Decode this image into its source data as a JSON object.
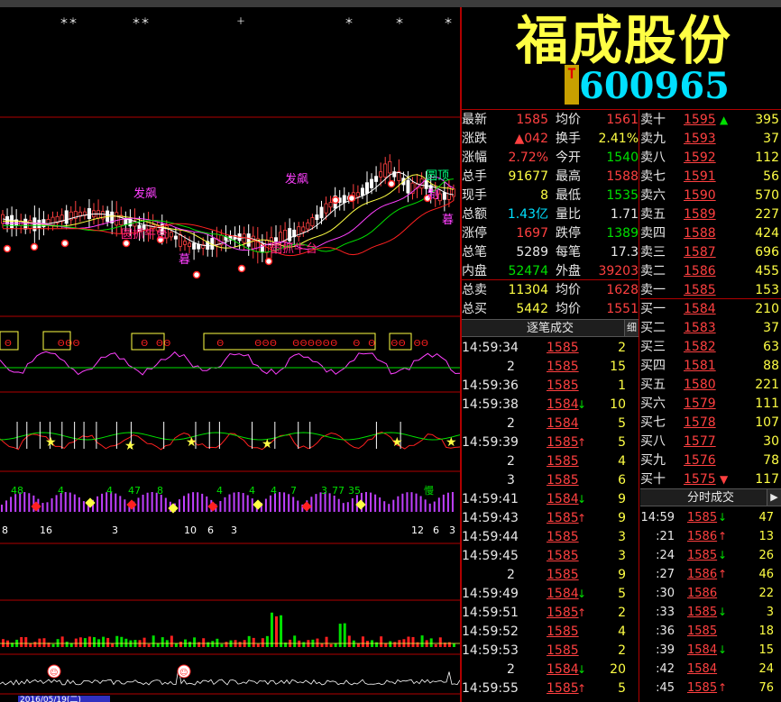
{
  "header": {
    "stock_name": "福成股份",
    "t_badge": "T",
    "stock_code": "600965"
  },
  "quote": [
    {
      "l1": "最新",
      "v1": "1585",
      "c1": "red",
      "l2": "均价",
      "v2": "1561",
      "c2": "red"
    },
    {
      "l1": "涨跌",
      "v1": "▲042",
      "c1": "red",
      "l2": "换手",
      "v2": "2.41%",
      "c2": "yellow"
    },
    {
      "l1": "涨幅",
      "v1": "2.72%",
      "c1": "red",
      "l2": "今开",
      "v2": "1540",
      "c2": "green"
    },
    {
      "l1": "总手",
      "v1": "91677",
      "c1": "yellow",
      "l2": "最高",
      "v2": "1588",
      "c2": "red"
    },
    {
      "l1": "现手",
      "v1": "8",
      "c1": "yellow",
      "l2": "最低",
      "v2": "1535",
      "c2": "green"
    },
    {
      "l1": "总额",
      "v1": "1.43亿",
      "c1": "cyan",
      "l2": "量比",
      "v2": "1.71",
      "c2": "white"
    },
    {
      "l1": "涨停",
      "v1": "1697",
      "c1": "red",
      "l2": "跌停",
      "v2": "1389",
      "c2": "green"
    },
    {
      "l1": "总笔",
      "v1": "5289",
      "c1": "white",
      "l2": "每笔",
      "v2": "17.3",
      "c2": "white"
    },
    {
      "l1": "内盘",
      "v1": "52474",
      "c1": "green",
      "l2": "外盘",
      "v2": "39203",
      "c2": "red"
    }
  ],
  "totals": [
    {
      "l1": "总卖",
      "v1": "11304",
      "c1": "yellow",
      "l2": "均价",
      "v2": "1628",
      "c2": "red"
    },
    {
      "l1": "总买",
      "v1": "5442",
      "c1": "yellow",
      "l2": "均价",
      "v2": "1551",
      "c2": "red"
    }
  ],
  "sell_orders": [
    {
      "label": "卖十",
      "price": "1595",
      "arrow": "▲",
      "arrow_color": "green",
      "vol": "395"
    },
    {
      "label": "卖九",
      "price": "1593",
      "arrow": "",
      "arrow_color": "",
      "vol": "37"
    },
    {
      "label": "卖八",
      "price": "1592",
      "arrow": "",
      "arrow_color": "",
      "vol": "112"
    },
    {
      "label": "卖七",
      "price": "1591",
      "arrow": "",
      "arrow_color": "",
      "vol": "56"
    },
    {
      "label": "卖六",
      "price": "1590",
      "arrow": "",
      "arrow_color": "",
      "vol": "570"
    },
    {
      "label": "卖五",
      "price": "1589",
      "arrow": "",
      "arrow_color": "",
      "vol": "227"
    },
    {
      "label": "卖四",
      "price": "1588",
      "arrow": "",
      "arrow_color": "",
      "vol": "424"
    },
    {
      "label": "卖三",
      "price": "1587",
      "arrow": "",
      "arrow_color": "",
      "vol": "696"
    },
    {
      "label": "卖二",
      "price": "1586",
      "arrow": "",
      "arrow_color": "",
      "vol": "455"
    },
    {
      "label": "卖一",
      "price": "1585",
      "arrow": "",
      "arrow_color": "",
      "vol": "153"
    }
  ],
  "buy_orders": [
    {
      "label": "买一",
      "price": "1584",
      "arrow": "",
      "arrow_color": "",
      "vol": "210"
    },
    {
      "label": "买二",
      "price": "1583",
      "arrow": "",
      "arrow_color": "",
      "vol": "37"
    },
    {
      "label": "买三",
      "price": "1582",
      "arrow": "",
      "arrow_color": "",
      "vol": "63"
    },
    {
      "label": "买四",
      "price": "1581",
      "arrow": "",
      "arrow_color": "",
      "vol": "88"
    },
    {
      "label": "买五",
      "price": "1580",
      "arrow": "",
      "arrow_color": "",
      "vol": "221"
    },
    {
      "label": "买六",
      "price": "1579",
      "arrow": "",
      "arrow_color": "",
      "vol": "111"
    },
    {
      "label": "买七",
      "price": "1578",
      "arrow": "",
      "arrow_color": "",
      "vol": "107"
    },
    {
      "label": "买八",
      "price": "1577",
      "arrow": "",
      "arrow_color": "",
      "vol": "30"
    },
    {
      "label": "买九",
      "price": "1576",
      "arrow": "",
      "arrow_color": "",
      "vol": "78"
    },
    {
      "label": "买十",
      "price": "1575",
      "arrow": "▼",
      "arrow_color": "red",
      "vol": "117"
    }
  ],
  "tabs": {
    "ticks_title": "逐笔成交",
    "ticks_detail": "细",
    "minute_title": "分时成交",
    "minute_arrow": "▶"
  },
  "ticks": [
    {
      "time": "14:59:34",
      "price": "1585",
      "arrow": "",
      "color": "red",
      "vol": "2"
    },
    {
      "time": "2",
      "price": "1585",
      "arrow": "",
      "color": "red",
      "vol": "15"
    },
    {
      "time": "14:59:36",
      "price": "1585",
      "arrow": "",
      "color": "red",
      "vol": "1"
    },
    {
      "time": "14:59:38",
      "price": "1584",
      "arrow": "↓",
      "color": "red",
      "vol": "10"
    },
    {
      "time": "2",
      "price": "1584",
      "arrow": "",
      "color": "red",
      "vol": "5"
    },
    {
      "time": "14:59:39",
      "price": "1585",
      "arrow": "↑",
      "color": "red",
      "vol": "5"
    },
    {
      "time": "2",
      "price": "1585",
      "arrow": "",
      "color": "red",
      "vol": "4"
    },
    {
      "time": "3",
      "price": "1585",
      "arrow": "",
      "color": "red",
      "vol": "6"
    },
    {
      "time": "14:59:41",
      "price": "1584",
      "arrow": "↓",
      "color": "red",
      "vol": "9"
    },
    {
      "time": "14:59:43",
      "price": "1585",
      "arrow": "↑",
      "color": "red",
      "vol": "9"
    },
    {
      "time": "14:59:44",
      "price": "1585",
      "arrow": "",
      "color": "red",
      "vol": "3"
    },
    {
      "time": "14:59:45",
      "price": "1585",
      "arrow": "",
      "color": "red",
      "vol": "3"
    },
    {
      "time": "2",
      "price": "1585",
      "arrow": "",
      "color": "red",
      "vol": "9"
    },
    {
      "time": "14:59:49",
      "price": "1584",
      "arrow": "↓",
      "color": "red",
      "vol": "5"
    },
    {
      "time": "14:59:51",
      "price": "1585",
      "arrow": "↑",
      "color": "red",
      "vol": "2"
    },
    {
      "time": "14:59:52",
      "price": "1585",
      "arrow": "",
      "color": "red",
      "vol": "4"
    },
    {
      "time": "14:59:53",
      "price": "1585",
      "arrow": "",
      "color": "red",
      "vol": "2"
    },
    {
      "time": "2",
      "price": "1584",
      "arrow": "↓",
      "color": "red",
      "vol": "20"
    },
    {
      "time": "14:59:55",
      "price": "1585",
      "arrow": "↑",
      "color": "red",
      "vol": "5"
    }
  ],
  "minutes": [
    {
      "time": "14:59",
      "price": "1585",
      "arrow": "↓",
      "vol": "47"
    },
    {
      "time": ":21",
      "price": "1586",
      "arrow": "↑",
      "vol": "13"
    },
    {
      "time": ":24",
      "price": "1585",
      "arrow": "↓",
      "vol": "26"
    },
    {
      "time": ":27",
      "price": "1586",
      "arrow": "↑",
      "vol": "46"
    },
    {
      "time": ":30",
      "price": "1586",
      "arrow": "",
      "vol": "22"
    },
    {
      "time": ":33",
      "price": "1585",
      "arrow": "↓",
      "vol": "3"
    },
    {
      "time": ":36",
      "price": "1585",
      "arrow": "",
      "vol": "18"
    },
    {
      "time": ":39",
      "price": "1584",
      "arrow": "↓",
      "vol": "15"
    },
    {
      "time": ":42",
      "price": "1584",
      "arrow": "",
      "vol": "24"
    },
    {
      "time": ":45",
      "price": "1585",
      "arrow": "↑",
      "vol": "76"
    }
  ],
  "chart_labels": {
    "fa_piao_1": "发飙",
    "fa_piao_2": "发飙",
    "guan_ding": "圆顶",
    "zhua_niu_1": "圆抓牛台",
    "zhua_niu_2": "圆抓牛台",
    "mu_1": "暮",
    "mu_2": "暮",
    "zhi": "制",
    "date_axis": "2016/05/19(二)",
    "ind_nums": [
      "48",
      "4",
      "4",
      "47",
      "8",
      "4",
      "4",
      "4",
      "7",
      "3",
      "77",
      "35",
      "慢"
    ],
    "ind_bottom": [
      "8",
      "16",
      "3",
      "10",
      "6",
      "3",
      "12",
      "6",
      "3"
    ]
  },
  "colors": {
    "up": "#ff4040",
    "down": "#00e000",
    "grid": "#b00000",
    "accent": "#ffff44",
    "code": "#00e0ff"
  }
}
